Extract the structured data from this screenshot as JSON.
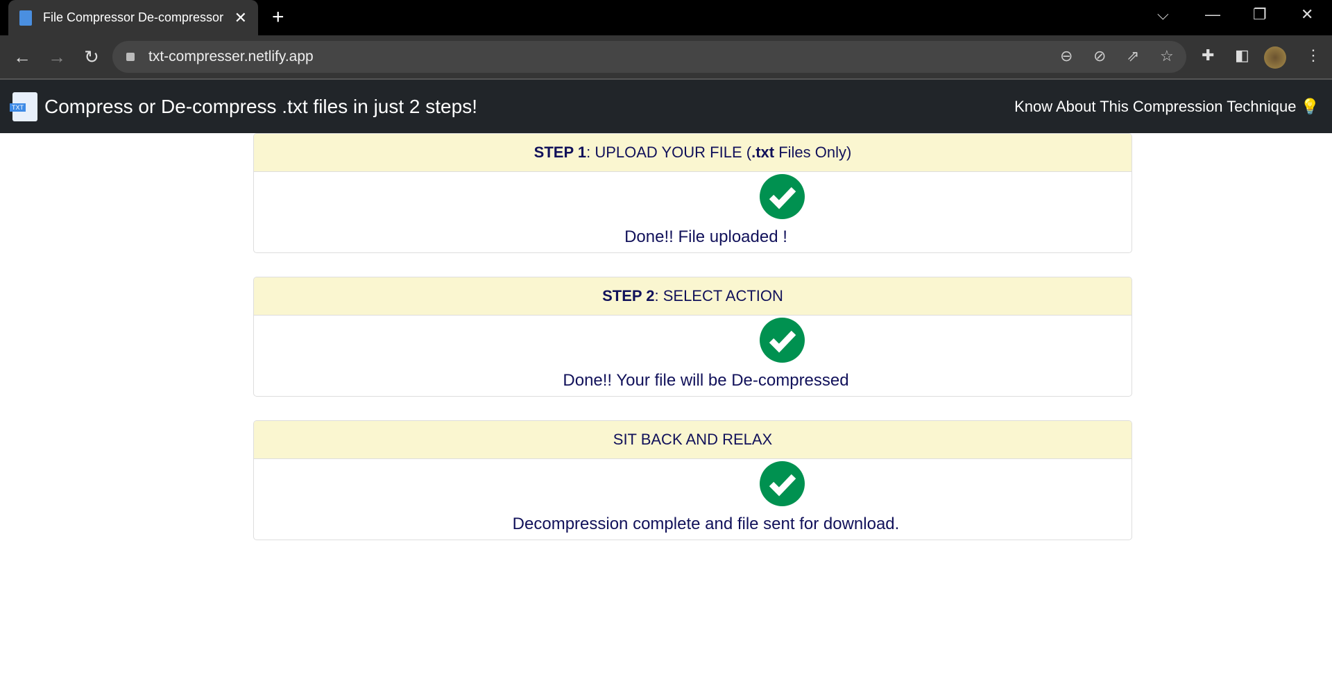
{
  "browser": {
    "tab_title": "File Compressor De-compressor",
    "url": "txt-compresser.netlify.app"
  },
  "app": {
    "title": "Compress or De-compress .txt files in just 2 steps!",
    "logo_text": "TXT",
    "nav_link": "Know About This Compression Technique 💡"
  },
  "colors": {
    "success": "#009150",
    "header_bg": "#faf6d0",
    "navbar": "#212529",
    "text": "#11115a"
  },
  "steps": [
    {
      "bold": "STEP 1",
      "rest": ": UPLOAD YOUR FILE (",
      "bold2": ".txt",
      "rest2": " Files Only)",
      "message": "Done!! File uploaded !",
      "status_icon": "check-circle"
    },
    {
      "bold": "STEP 2",
      "rest": ": SELECT ACTION",
      "message": "Done!! Your file will be De-compressed",
      "status_icon": "check-circle"
    },
    {
      "rest": "SIT BACK AND RELAX",
      "message": "Decompression complete and file sent for download.",
      "status_icon": "check-circle"
    }
  ]
}
